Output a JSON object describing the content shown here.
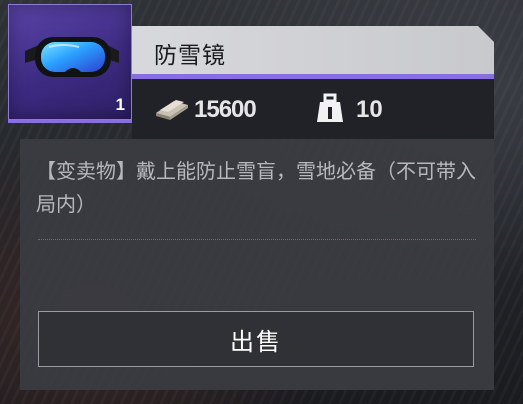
{
  "item": {
    "name": "防雪镜",
    "count": "1",
    "price": "15600",
    "weight": "10",
    "description": "【变卖物】戴上能防止雪盲，雪地必备（不可带入局内）",
    "rarity_color": "#5a44a8",
    "accent_color": "#8a6ee0",
    "icon": "ski-goggles-icon"
  },
  "actions": {
    "sell_label": "出售"
  },
  "icons": {
    "price": "silver-bar-icon",
    "weight": "weight-icon"
  }
}
